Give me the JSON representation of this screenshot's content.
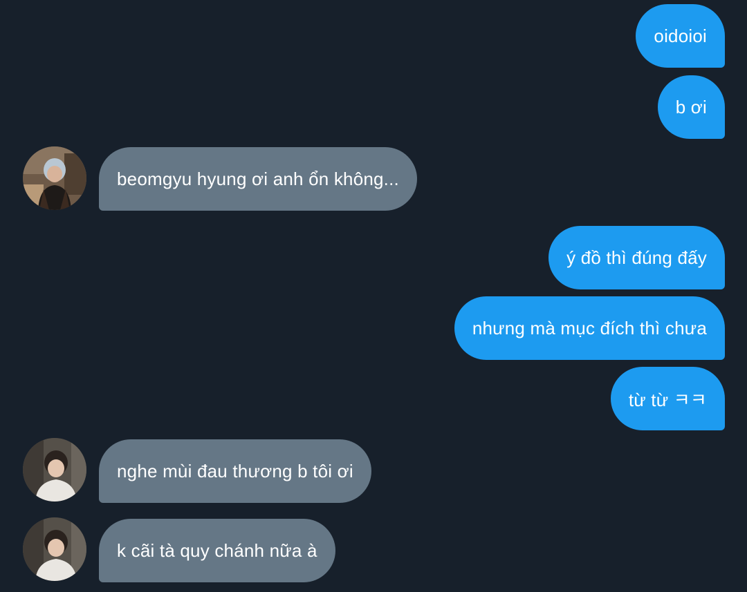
{
  "messages": [
    {
      "side": "sent",
      "text": "oidoioi"
    },
    {
      "side": "sent",
      "text": "b ơi"
    },
    {
      "side": "received",
      "avatar": "avatar-photo-1",
      "text": "beomgyu hyung ơi anh ổn không..."
    },
    {
      "side": "sent",
      "text": "ý đồ thì đúng đấy"
    },
    {
      "side": "sent",
      "text": "nhưng mà mục đích thì chưa"
    },
    {
      "side": "sent",
      "text": "từ từ ㅋㅋ"
    },
    {
      "side": "received",
      "avatar": "avatar-photo-2",
      "text": "nghe mùi đau thương b tôi ơi"
    },
    {
      "side": "received",
      "avatar": "avatar-photo-2",
      "text": "k cãi tà quy chánh nữa à"
    }
  ],
  "colors": {
    "background": "#17202b",
    "sent_bubble": "#1d9bf0",
    "received_bubble": "#657786",
    "text": "#ffffff"
  }
}
